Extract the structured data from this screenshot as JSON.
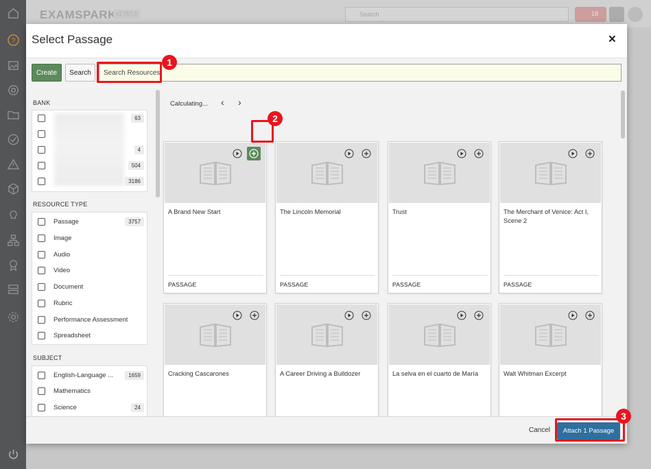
{
  "app": {
    "logo": "EXAMSPARK",
    "version": "v1.757.3",
    "search_placeholder": "Search",
    "notification_count": "18"
  },
  "modal": {
    "title": "Select Passage",
    "close_label": "×",
    "create_label": "Create",
    "search_label": "Search",
    "search_placeholder": "Search Resources",
    "cancel_label": "Cancel",
    "attach_label": "Attach 1 Passage"
  },
  "callouts": [
    "1",
    "2",
    "3"
  ],
  "filters": {
    "bank": {
      "heading": "BANK",
      "items": [
        {
          "count": "63"
        },
        {
          "count": ""
        },
        {
          "count": "4"
        },
        {
          "count": "504"
        },
        {
          "count": "3186"
        }
      ]
    },
    "resource_type": {
      "heading": "RESOURCE TYPE",
      "items": [
        {
          "label": "Passage",
          "count": "3757"
        },
        {
          "label": "Image",
          "count": ""
        },
        {
          "label": "Audio",
          "count": ""
        },
        {
          "label": "Video",
          "count": ""
        },
        {
          "label": "Document",
          "count": ""
        },
        {
          "label": "Rubric",
          "count": ""
        },
        {
          "label": "Performance Assessment",
          "count": ""
        },
        {
          "label": "Spreadsheet",
          "count": ""
        }
      ]
    },
    "subject": {
      "heading": "SUBJECT",
      "items": [
        {
          "label": "English-Language ...",
          "count": "1659"
        },
        {
          "label": "Mathematics",
          "count": ""
        },
        {
          "label": "Science",
          "count": "24"
        }
      ]
    }
  },
  "results": {
    "status": "Calculating...",
    "prev": "‹",
    "next": "›",
    "cards": [
      {
        "title": "A Brand New Start",
        "type": "PASSAGE"
      },
      {
        "title": "The Lincoln Memorial",
        "type": "PASSAGE"
      },
      {
        "title": "Trust",
        "type": "PASSAGE"
      },
      {
        "title": "The Merchant of Venice: Act I, Scene 2",
        "type": "PASSAGE"
      },
      {
        "title": "Cracking Cascarones",
        "type": ""
      },
      {
        "title": "A Career Driving a Bulldozer",
        "type": ""
      },
      {
        "title": "La selva en el cuarto de María",
        "type": ""
      },
      {
        "title": "Walt Whitman Excerpt",
        "type": ""
      }
    ]
  },
  "colors": {
    "create_green": "#5c8a5c",
    "attach_blue": "#2f6f9e",
    "callout_red": "#e8151f"
  }
}
